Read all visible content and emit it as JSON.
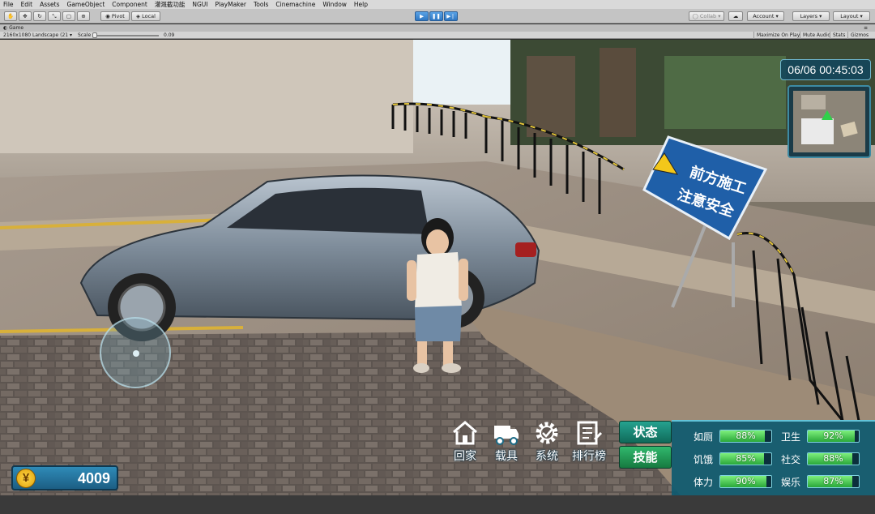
{
  "menubar": {
    "items": [
      "File",
      "Edit",
      "Assets",
      "GameObject",
      "Component",
      "灌溉截功能",
      "NGUI",
      "PlayMaker",
      "Tools",
      "Cinemachine",
      "Window",
      "Help"
    ]
  },
  "toolbar": {
    "pivot": "Pivot",
    "local": "Local",
    "collab": "Collab",
    "account": "Account",
    "layers": "Layers",
    "layout": "Layout"
  },
  "gameview": {
    "tab_title": "Game",
    "resolution": "2160x1080 Landscape (21",
    "scale_label": "Scale",
    "scale_value": "0.09",
    "maximize": "Maximize On Play",
    "mute": "Mute Audio",
    "stats": "Stats",
    "gizmos": "Gizmos"
  },
  "hud": {
    "datetime": "06/06 00:45:03",
    "sign_line1": "前方施工",
    "sign_line2": "注意安全",
    "currency_symbol": "¥",
    "money": "4009",
    "menu": [
      {
        "label": "回家",
        "icon": "home-icon"
      },
      {
        "label": "载具",
        "icon": "truck-icon"
      },
      {
        "label": "系统",
        "icon": "gear-icon"
      },
      {
        "label": "排行榜",
        "icon": "leaderboard-icon"
      }
    ],
    "tabs": {
      "status": "状态",
      "skill": "技能"
    },
    "stats": [
      {
        "name": "如厕",
        "value": "88%",
        "level": 0.88
      },
      {
        "name": "卫生",
        "value": "92%",
        "level": 0.92
      },
      {
        "name": "饥饿",
        "value": "85%",
        "level": 0.85
      },
      {
        "name": "社交",
        "value": "88%",
        "level": 0.88
      },
      {
        "name": "体力",
        "value": "90%",
        "level": 0.9
      },
      {
        "name": "娱乐",
        "value": "87%",
        "level": 0.87
      }
    ]
  }
}
